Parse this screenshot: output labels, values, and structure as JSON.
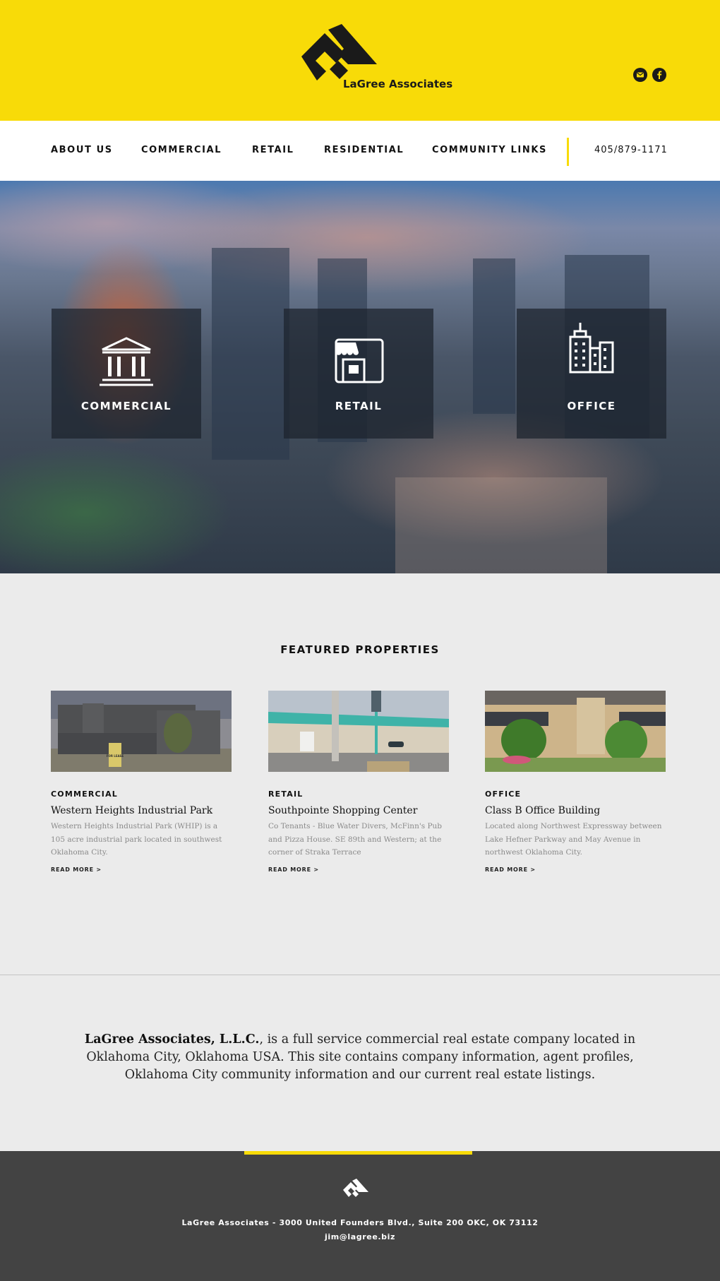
{
  "brand": {
    "name": "LaGree Associates",
    "accent_color": "#f8db08",
    "dark_color": "#434343"
  },
  "header": {
    "social_icons": [
      "mail-icon",
      "facebook-icon"
    ]
  },
  "nav": {
    "items": [
      {
        "label": "ABOUT US"
      },
      {
        "label": "COMMERCIAL"
      },
      {
        "label": "RETAIL"
      },
      {
        "label": "RESIDENTIAL"
      },
      {
        "label": "COMMUNITY LINKS"
      }
    ],
    "phone": "405/879-1171"
  },
  "hero": {
    "tiles": [
      {
        "label": "COMMERCIAL",
        "icon": "bank-columns-icon"
      },
      {
        "label": "RETAIL",
        "icon": "storefront-icon"
      },
      {
        "label": "OFFICE",
        "icon": "office-building-icon"
      }
    ]
  },
  "featured": {
    "title": "FEATURED PROPERTIES",
    "cards": [
      {
        "category": "COMMERCIAL",
        "title": "Western Heights Industrial Park",
        "description": "Western Heights Industrial Park (WHIP) is a 105 acre industrial park located in southwest Oklahoma City.",
        "more": "READ MORE >",
        "photo_sign": "FOR LEASE"
      },
      {
        "category": "RETAIL",
        "title": "Southpointe Shopping Center",
        "description": "Co Tenants - Blue Water Divers, McFinn's Pub and Pizza House. SE 89th and Western; at the corner of Straka Terrace",
        "more": "READ MORE >"
      },
      {
        "category": "OFFICE",
        "title": "Class B Office Building",
        "description": "Located along Northwest Expressway between Lake Hefner Parkway and May Avenue in northwest Oklahoma City.",
        "more": "READ MORE >"
      }
    ]
  },
  "about": {
    "company": "LaGree Associates, L.L.C.",
    "text": ", is a full service commercial real estate company located in Oklahoma City, Oklahoma USA. This site contains company information, agent profiles, Oklahoma City community information and our current real estate listings."
  },
  "footer": {
    "address": "LaGree Associates - 3000 United Founders Blvd., Suite 200 OKC, OK 73112",
    "email": "jim@lagree.biz"
  }
}
